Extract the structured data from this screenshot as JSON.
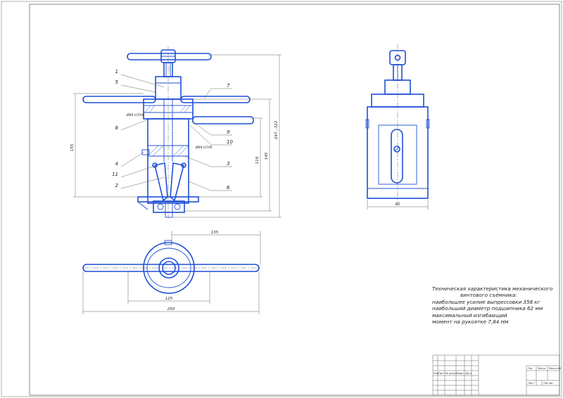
{
  "colors": {
    "outline": "#1f4fd6",
    "lines": "#3a3a3a",
    "paper": "#ffffff"
  },
  "front_view": {
    "part_numbers": [
      "1",
      "5",
      "8",
      "4",
      "11",
      "2",
      "7",
      "9",
      "10",
      "3",
      "6"
    ],
    "fits": [
      "Ø69 H7/h6",
      "Ø69 H7/f6"
    ],
    "dimensions": {
      "overall_left": "155",
      "right_inner": "110",
      "right_mid": "145",
      "right_outer": "247...322"
    }
  },
  "side_view": {
    "width_dim": "92"
  },
  "top_view": {
    "dim_top": "135",
    "dim_mid": "125",
    "dim_bottom": "250"
  },
  "tech_note": {
    "lines": [
      "Техническая характеристика механического",
      "винтового съёмника:",
      "наибольшее усилие выпрессовки 358 кг",
      "наибольший диаметр подшипника 62 мм",
      "максимальный изгибающий",
      "момент на рукоятке 7,84 Нм"
    ]
  },
  "title_block": {
    "headers": [
      "Изм",
      "Лист",
      "№ докум.",
      "Подп.",
      "Дата"
    ],
    "right_headers": [
      "Лит",
      "Масса",
      "Масштаб"
    ],
    "sheet_labels": [
      "Лист",
      "Листов"
    ]
  }
}
